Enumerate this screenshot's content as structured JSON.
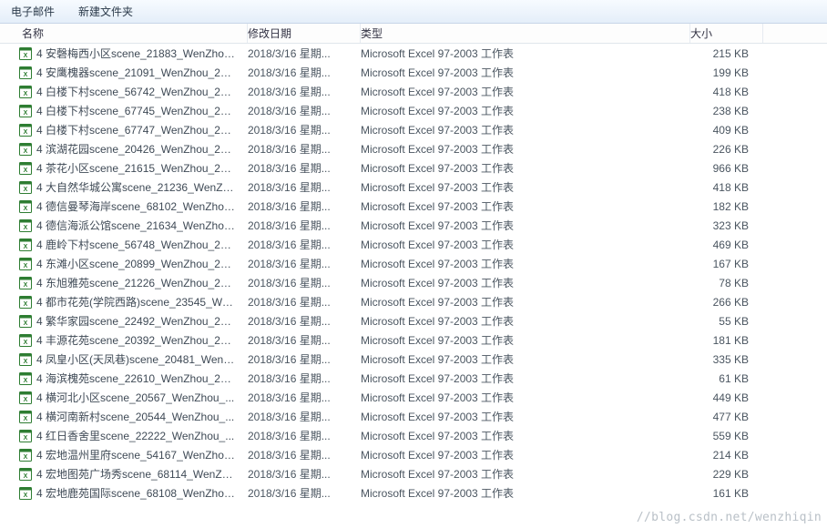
{
  "toolbar": {
    "email_label": "电子邮件",
    "new_folder_label": "新建文件夹"
  },
  "columns": {
    "name": "名称",
    "date": "修改日期",
    "type": "类型",
    "size": "大小"
  },
  "file_type_label": "Microsoft Excel 97-2003 工作表",
  "files": [
    {
      "name": "4 安磬梅西小区scene_21883_WenZhou...",
      "date": "2018/3/16 星期...",
      "size": "215 KB"
    },
    {
      "name": "4 安鹰槐器scene_21091_WenZhou_20...",
      "date": "2018/3/16 星期...",
      "size": "199 KB"
    },
    {
      "name": "4 白楼下村scene_56742_WenZhou_20...",
      "date": "2018/3/16 星期...",
      "size": "418 KB"
    },
    {
      "name": "4 白楼下村scene_67745_WenZhou_20...",
      "date": "2018/3/16 星期...",
      "size": "238 KB"
    },
    {
      "name": "4 白楼下村scene_67747_WenZhou_20...",
      "date": "2018/3/16 星期...",
      "size": "409 KB"
    },
    {
      "name": "4 滨湖花园scene_20426_WenZhou_20...",
      "date": "2018/3/16 星期...",
      "size": "226 KB"
    },
    {
      "name": "4 茶花小区scene_21615_WenZhou_20...",
      "date": "2018/3/16 星期...",
      "size": "966 KB"
    },
    {
      "name": "4 大自然华城公寓scene_21236_WenZh...",
      "date": "2018/3/16 星期...",
      "size": "418 KB"
    },
    {
      "name": "4 德信曼琴海岸scene_68102_WenZhou...",
      "date": "2018/3/16 星期...",
      "size": "182 KB"
    },
    {
      "name": "4 德信海派公馆scene_21634_WenZhou...",
      "date": "2018/3/16 星期...",
      "size": "323 KB"
    },
    {
      "name": "4 鹿岭下村scene_56748_WenZhou_20...",
      "date": "2018/3/16 星期...",
      "size": "469 KB"
    },
    {
      "name": "4 东滩小区scene_20899_WenZhou_20...",
      "date": "2018/3/16 星期...",
      "size": "167 KB"
    },
    {
      "name": "4 东旭雅苑scene_21226_WenZhou_20...",
      "date": "2018/3/16 星期...",
      "size": "78 KB"
    },
    {
      "name": "4 都市花苑(学院西路)scene_23545_We...",
      "date": "2018/3/16 星期...",
      "size": "266 KB"
    },
    {
      "name": "4 繁华家园scene_22492_WenZhou_20...",
      "date": "2018/3/16 星期...",
      "size": "55 KB"
    },
    {
      "name": "4 丰源花苑scene_20392_WenZhou_20...",
      "date": "2018/3/16 星期...",
      "size": "181 KB"
    },
    {
      "name": "4 凤皇小区(天凤巷)scene_20481_WenZ...",
      "date": "2018/3/16 星期...",
      "size": "335 KB"
    },
    {
      "name": "4 海滨槐苑scene_22610_WenZhou_20...",
      "date": "2018/3/16 星期...",
      "size": "61 KB"
    },
    {
      "name": "4 横河北小区scene_20567_WenZhou_...",
      "date": "2018/3/16 星期...",
      "size": "449 KB"
    },
    {
      "name": "4 横河南新村scene_20544_WenZhou_...",
      "date": "2018/3/16 星期...",
      "size": "477 KB"
    },
    {
      "name": "4 红日香舍里scene_22222_WenZhou_...",
      "date": "2018/3/16 星期...",
      "size": "559 KB"
    },
    {
      "name": "4 宏地温州里府scene_54167_WenZhou...",
      "date": "2018/3/16 星期...",
      "size": "214 KB"
    },
    {
      "name": "4 宏地图苑广场秀scene_68114_WenZh...",
      "date": "2018/3/16 星期...",
      "size": "229 KB"
    },
    {
      "name": "4 宏地鹿苑国际scene_68108_WenZhou...",
      "date": "2018/3/16 星期...",
      "size": "161 KB"
    }
  ],
  "watermark": "//blog.csdn.net/wenzhiqin"
}
